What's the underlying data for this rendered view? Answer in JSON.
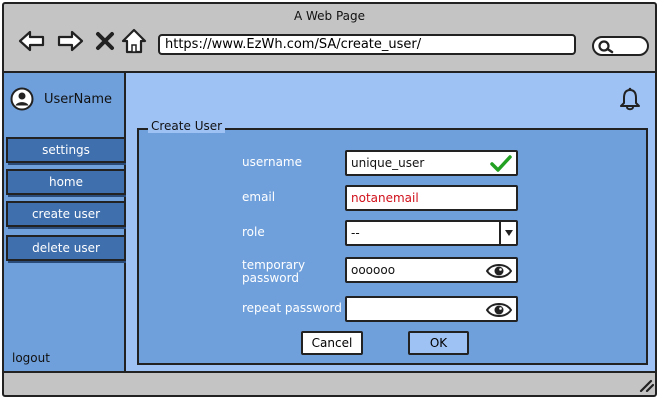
{
  "window": {
    "title": "A Web Page"
  },
  "browser": {
    "url": "https://www.EzWh.com/SA/create_user/",
    "icons": [
      "back-arrow-icon",
      "forward-arrow-icon",
      "close-icon",
      "home-icon",
      "search-icon"
    ]
  },
  "sidebar": {
    "user_name": "UserName",
    "items": [
      {
        "label": "settings"
      },
      {
        "label": "home"
      },
      {
        "label": "create user"
      },
      {
        "label": "delete user"
      }
    ],
    "logout": "logout"
  },
  "form": {
    "legend": "Create User",
    "fields": {
      "username": {
        "label": "username",
        "value": "unique_user",
        "status": "valid"
      },
      "email": {
        "label": "email",
        "value": "notanemail",
        "status": "invalid"
      },
      "role": {
        "label": "role",
        "value": "--"
      },
      "temporary_password": {
        "label_line1": "temporary",
        "label_line2": "password",
        "value": "oooooo"
      },
      "repeat_password": {
        "label": "repeat password",
        "value": ""
      }
    },
    "buttons": {
      "cancel": "Cancel",
      "ok": "OK"
    }
  },
  "colors": {
    "chrome": "#c4c4c4",
    "sidebar": "#6fa0dc",
    "sidebar_item": "#3f6fad",
    "content": "#9fc2f5",
    "error_text": "#d0101a",
    "valid_check": "#22a022"
  }
}
